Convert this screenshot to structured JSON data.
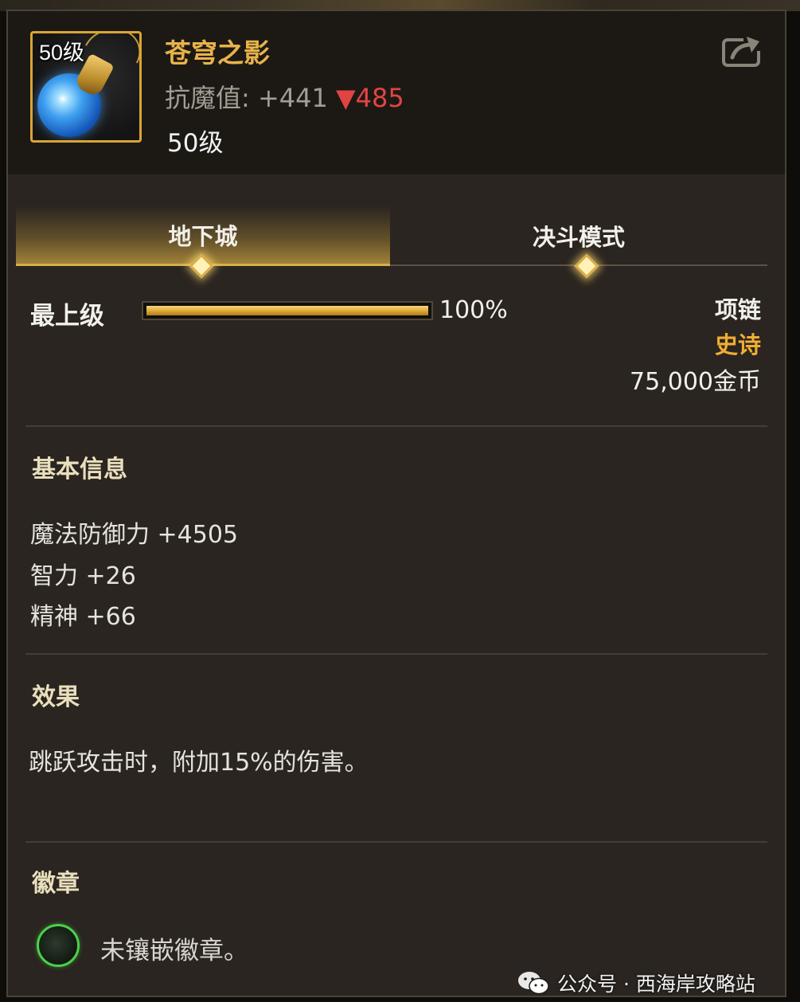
{
  "item": {
    "level_badge": "50级",
    "name": "苍穹之影",
    "magic_resistance": {
      "label": "抗魔值:",
      "value": "+441",
      "diff_arrow": "▼",
      "diff": "485"
    },
    "required_level": "50级",
    "slot_type": "项链",
    "rarity": "史诗",
    "price": "75,000金币",
    "accent_color": "#e8b34a",
    "rarity_color": "#f0ad32"
  },
  "tabs": [
    {
      "label": "地下城",
      "active": true
    },
    {
      "label": "决斗模式",
      "active": false
    }
  ],
  "progress": {
    "label": "最上级",
    "value": 1.0,
    "text": "100%"
  },
  "basic_info": {
    "title": "基本信息",
    "stats": [
      "魔法防御力 +4505",
      "智力 +26",
      "精神 +66"
    ]
  },
  "effect": {
    "title": "效果",
    "text": "跳跃攻击时，附加15%的伤害。"
  },
  "emblem": {
    "title": "徽章",
    "text": "未镶嵌徽章。"
  },
  "watermark": {
    "text": "公众号 · 西海岸攻略站"
  },
  "icons": {
    "share": "share-icon",
    "item": "necklace-blue-orb-icon",
    "emblem_slot": "emblem-slot-icon",
    "watermark_logo": "wechat-icon"
  }
}
